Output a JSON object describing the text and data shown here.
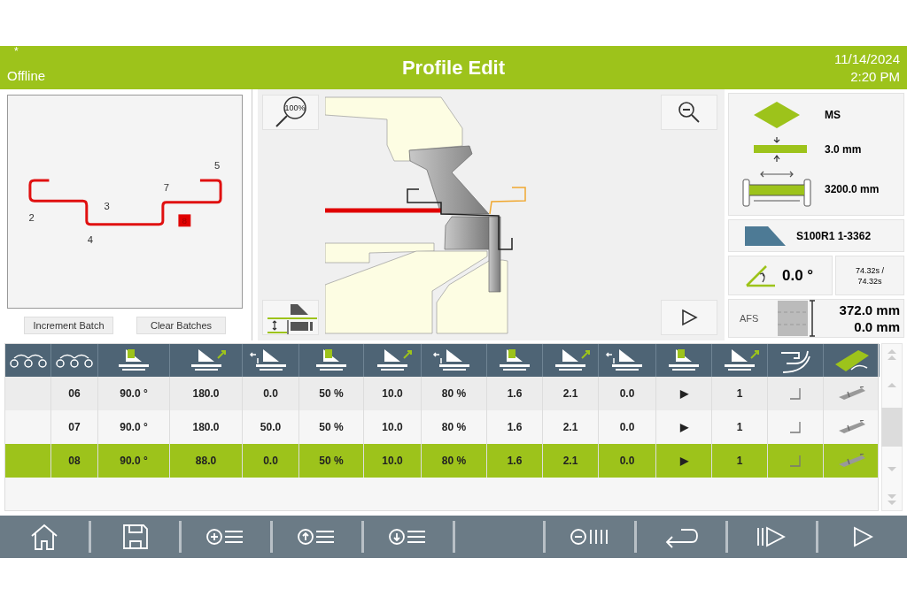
{
  "header": {
    "marker": "*",
    "status": "Offline",
    "title": "Profile Edit",
    "date": "11/14/2024",
    "time": "2:20 PM"
  },
  "profile_view": {
    "labels": [
      "2",
      "3",
      "4",
      "5",
      "7"
    ],
    "current_bend": "8"
  },
  "profile_buttons": [
    "Increment Batch",
    "Clear Batches"
  ],
  "machine_view": {
    "zoom_label": "100%"
  },
  "material": {
    "name": "MS",
    "thickness": "3.0 mm",
    "length": "3200.0 mm"
  },
  "tool": "S100R1 1-3362",
  "angle": "0.0 °",
  "time": [
    "74.32s /",
    "74.32s"
  ],
  "afs": {
    "label": "AFS",
    "values": [
      "372.0 mm",
      "0.0 mm"
    ]
  },
  "table": {
    "rows": [
      {
        "step": "06",
        "selected": false,
        "cells": [
          "90.0 °",
          "180.0",
          "0.0",
          "50 %",
          "10.0",
          "80 %",
          "1.6",
          "2.1",
          "0.0",
          "▶",
          "1"
        ]
      },
      {
        "step": "07",
        "selected": false,
        "cells": [
          "90.0 °",
          "180.0",
          "50.0",
          "50 %",
          "10.0",
          "80 %",
          "1.6",
          "2.1",
          "0.0",
          "▶",
          "1"
        ]
      },
      {
        "step": "08",
        "selected": true,
        "cells": [
          "90.0 °",
          "88.0",
          "0.0",
          "50 %",
          "10.0",
          "80 %",
          "1.6",
          "2.1",
          "0.0",
          "▶",
          "1"
        ]
      }
    ]
  }
}
